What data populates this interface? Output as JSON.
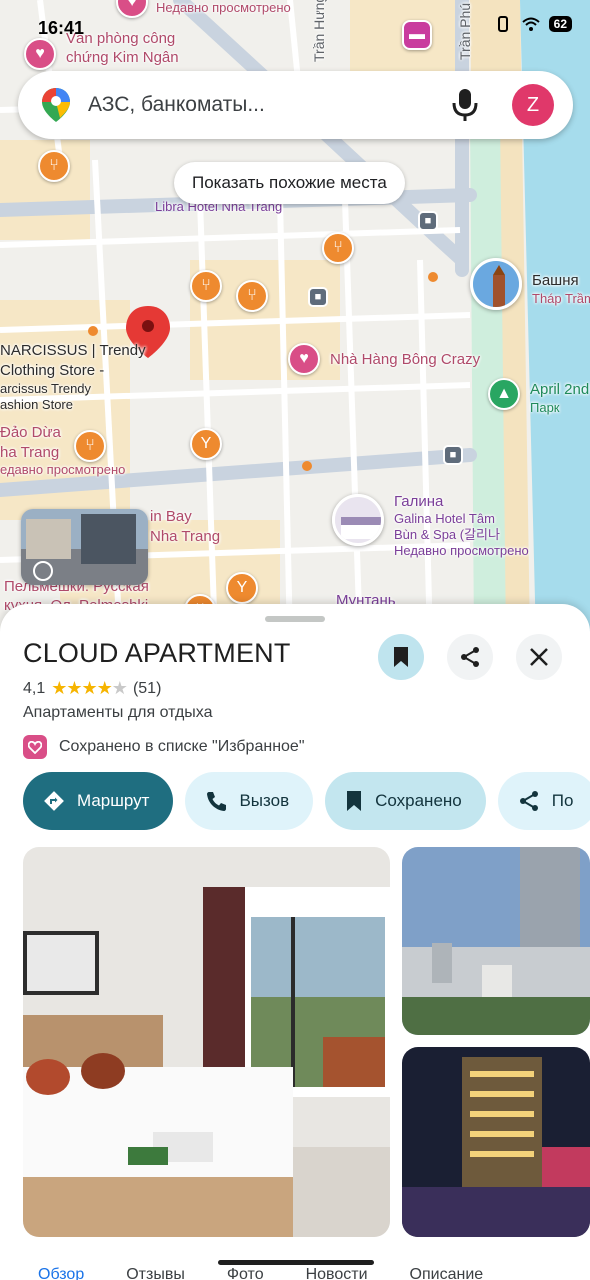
{
  "status": {
    "time": "16:41",
    "battery": "62"
  },
  "search": {
    "placeholder": "АЗС, банкоматы...",
    "avatar_letter": "Z"
  },
  "map": {
    "similar_chip": "Показать похожие места",
    "labels": {
      "recently_top": "Недавно просмотрено",
      "van_phong_1": "Văn phòng công",
      "van_phong_2": "chứng Kim Ngân",
      "road_tran_hung": "Trần Hưng",
      "road_tran_phu": "Trần Phú",
      "libra": "Libra Hotel Nha Trang",
      "bashnya": "Башня",
      "thap_tram": "Tháp Trầm",
      "narcissus_1": "NARCISSUS | Trendy",
      "narcissus_2": "Clothing Store -",
      "narcissus_3": "arcissus Trendy",
      "narcissus_4": "ashion Store",
      "bong_crazy": "Nhà Hàng Bông Crazy",
      "april_1": "April 2nd",
      "april_2": "Парк",
      "dao_dua_1": "Đảo Dừa",
      "dao_dua_2": "ha Trang",
      "dao_dua_3": "едавно просмотрено",
      "vinbay_1": "in Bay",
      "vinbay_2": "Nha Trang",
      "galina_1": "Галина",
      "galina_2": "Galina Hotel Tâm",
      "galina_3": "Bùn & Spa (갈리나",
      "galina_4": "Недавно просмотрено",
      "pelmeshki_1": "Пельмешки: Русская",
      "pelmeshki_2": "кухня, Ол. Pelmeshki",
      "muntan": "Мунтань"
    }
  },
  "place": {
    "title": "CLOUD APARTMENT",
    "rating": "4,1",
    "rating_value": 4.1,
    "reviews": "(51)",
    "category": "Апартаменты для отдыха",
    "saved_text": "Сохранено в списке \"Избранное\"",
    "actions": {
      "route": "Маршрут",
      "call": "Вызов",
      "saved": "Сохранено",
      "share": "По"
    }
  },
  "tabs": [
    "Обзор",
    "Отзывы",
    "Фото",
    "Новости",
    "Описание"
  ],
  "colors": {
    "accent": "#1f6e80",
    "tonal": "#dff3fa",
    "pin_red": "#e53935",
    "star": "#f6b400"
  }
}
